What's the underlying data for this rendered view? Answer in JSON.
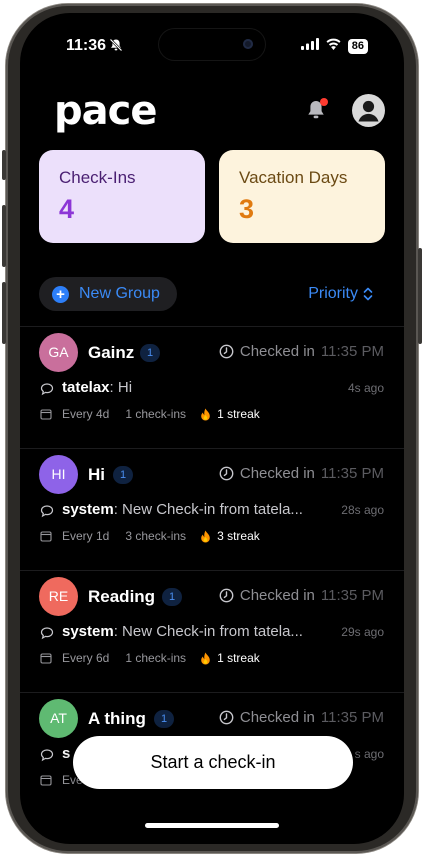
{
  "status": {
    "time": "11:36",
    "battery": "86"
  },
  "header": {
    "logo": "pace"
  },
  "stats": {
    "checkins": {
      "label": "Check-Ins",
      "value": "4"
    },
    "vacation": {
      "label": "Vacation Days",
      "value": "3"
    }
  },
  "toolbar": {
    "new_group_label": "New Group",
    "sort_label": "Priority"
  },
  "groups": [
    {
      "initials": "GA",
      "name": "Gainz",
      "badge": "1",
      "status": "Checked in",
      "time": "11:35 PM",
      "author": "tatelax",
      "message": ": Hi",
      "ago": "4s ago",
      "frequency": "Every 4d",
      "checkins": "1 check-ins",
      "streak": "1 streak",
      "color": "#c96f9c"
    },
    {
      "initials": "HI",
      "name": "Hi",
      "badge": "1",
      "status": "Checked in",
      "time": "11:35 PM",
      "author": "system",
      "message": ": New Check-in from tatela...",
      "ago": "28s ago",
      "frequency": "Every 1d",
      "checkins": "3 check-ins",
      "streak": "3 streak",
      "color": "#8e63e8"
    },
    {
      "initials": "RE",
      "name": "Reading",
      "badge": "1",
      "status": "Checked in",
      "time": "11:35 PM",
      "author": "system",
      "message": ": New Check-in from tatela...",
      "ago": "29s ago",
      "frequency": "Every 6d",
      "checkins": "1 check-ins",
      "streak": "1 streak",
      "color": "#ef6a5e"
    },
    {
      "initials": "AT",
      "name": "A thing",
      "badge": "1",
      "status": "Checked in",
      "time": "11:35 PM",
      "author": "s",
      "message": "",
      "ago": "s ago",
      "frequency": "Eve",
      "checkins": "",
      "streak": "",
      "color": "#5fba72"
    }
  ],
  "cta": {
    "label": "Start a check-in"
  },
  "colors": {
    "accent": "#3b8af5",
    "background": "#000000",
    "notification": "#ff3b30"
  }
}
